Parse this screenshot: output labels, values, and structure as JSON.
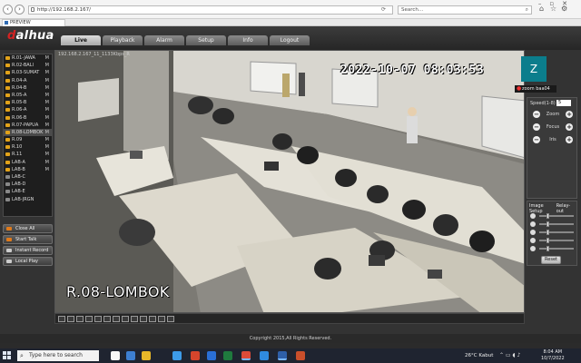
{
  "browser": {
    "url": "http://192.168.2.167/",
    "search_placeholder": "Search...",
    "tab_title": "PREVIEW"
  },
  "app": {
    "logo_main": "alhua",
    "logo_prefix": "d",
    "tabs": [
      {
        "label": "Live",
        "active": true
      },
      {
        "label": "Playback",
        "active": false
      },
      {
        "label": "Alarm",
        "active": false
      },
      {
        "label": "Setup",
        "active": false
      },
      {
        "label": "Info",
        "active": false
      },
      {
        "label": "Logout",
        "active": false
      }
    ]
  },
  "channels": [
    {
      "label": "R.01-JAWA",
      "m": "M"
    },
    {
      "label": "R.02-BALI",
      "m": "M"
    },
    {
      "label": "R.03-SUMAT",
      "m": "M"
    },
    {
      "label": "R.04-A",
      "m": "M"
    },
    {
      "label": "R.04-B",
      "m": "M"
    },
    {
      "label": "R.05-A",
      "m": "M"
    },
    {
      "label": "R.05-B",
      "m": "M"
    },
    {
      "label": "R.06-A",
      "m": "M"
    },
    {
      "label": "R.06-B",
      "m": "M"
    },
    {
      "label": "R.07-PAPUA",
      "m": "M"
    },
    {
      "label": "R.08-LOMBOK",
      "m": "M"
    },
    {
      "label": "R.09",
      "m": "M"
    },
    {
      "label": "R.10",
      "m": "M"
    },
    {
      "label": "R.11",
      "m": "M"
    },
    {
      "label": "LAB-A",
      "m": "M"
    },
    {
      "label": "LAB-B",
      "m": "M"
    },
    {
      "label": "LAB-C",
      "m": ""
    },
    {
      "label": "LAB-D",
      "m": ""
    },
    {
      "label": "LAB-E",
      "m": ""
    },
    {
      "label": "LAB-JRGN",
      "m": ""
    }
  ],
  "side_buttons": {
    "close_all": "Close All",
    "start_talk": "Start Talk",
    "instant_record": "Instant Record",
    "local_play": "Local Play"
  },
  "video": {
    "stream_info": "192.168.2.167_11_1133Kbps_R",
    "timestamp": "2022-10-07 08:03:53",
    "camera_label": "R.08-LOMBOK"
  },
  "zoom_overlay": {
    "initial": "Z",
    "name": "zoom baa04"
  },
  "ptz": {
    "speed_label": "Speed(1-8)",
    "speed_value": "5",
    "zoom_label": "Zoom",
    "focus_label": "Focus",
    "iris_label": "Iris"
  },
  "image_setup": {
    "tab1": "Image Setup",
    "tab2": "Relay-out",
    "sliders": [
      0.25,
      0.25,
      0.25,
      0.25,
      0.25
    ],
    "reset": "Reset"
  },
  "copyright": "Copyright 2015,All Rights Reserved.",
  "taskbar": {
    "search_text": "Type here to search",
    "weather": "26°C  Kabut",
    "time": "8:04 AM",
    "date": "10/7/2022"
  }
}
